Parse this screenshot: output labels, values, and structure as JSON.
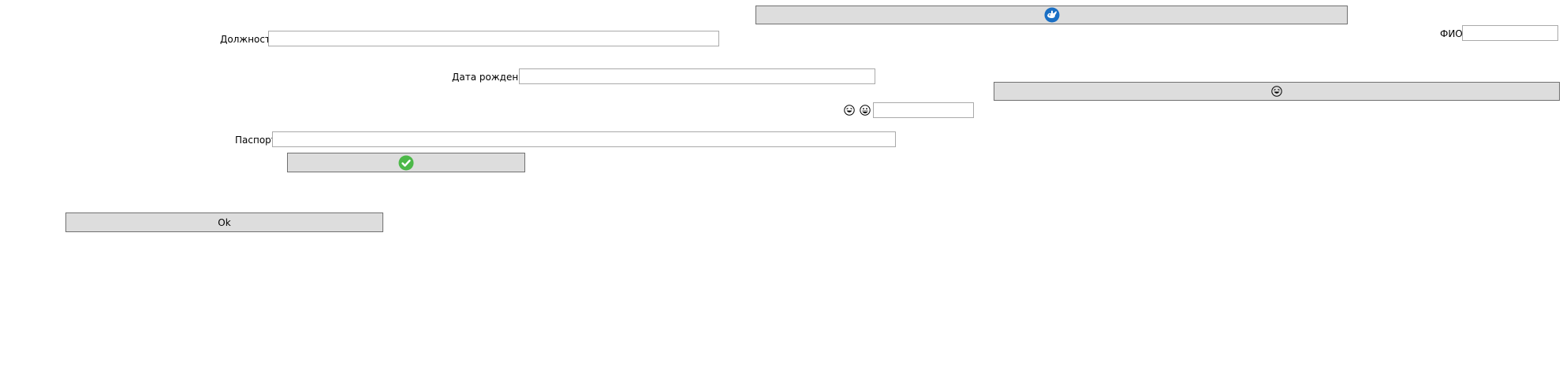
{
  "form": {
    "fio_label": "ФИО",
    "position_label": "Должность",
    "birthdate_label": "Дата рождения",
    "passport_label": "Паспорт",
    "ok_label": "Ok",
    "fio_value": "",
    "position_value": "",
    "birthdate_value": "",
    "passport_value": "",
    "emoji_field_value": ""
  },
  "icons": {
    "top_button_icon": "whale-icon",
    "right_button_icon": "laughing-face-icon",
    "emoji_label_icons": [
      "laughing-face-icon",
      "grinning-face-icon"
    ],
    "check_button_icon": "checkmark-icon"
  },
  "colors": {
    "button_bg": "#dddddd",
    "button_border": "#707070",
    "field_border": "#a9a9a9",
    "whale_blue": "#1a6fc4",
    "check_green": "#4cb848"
  }
}
